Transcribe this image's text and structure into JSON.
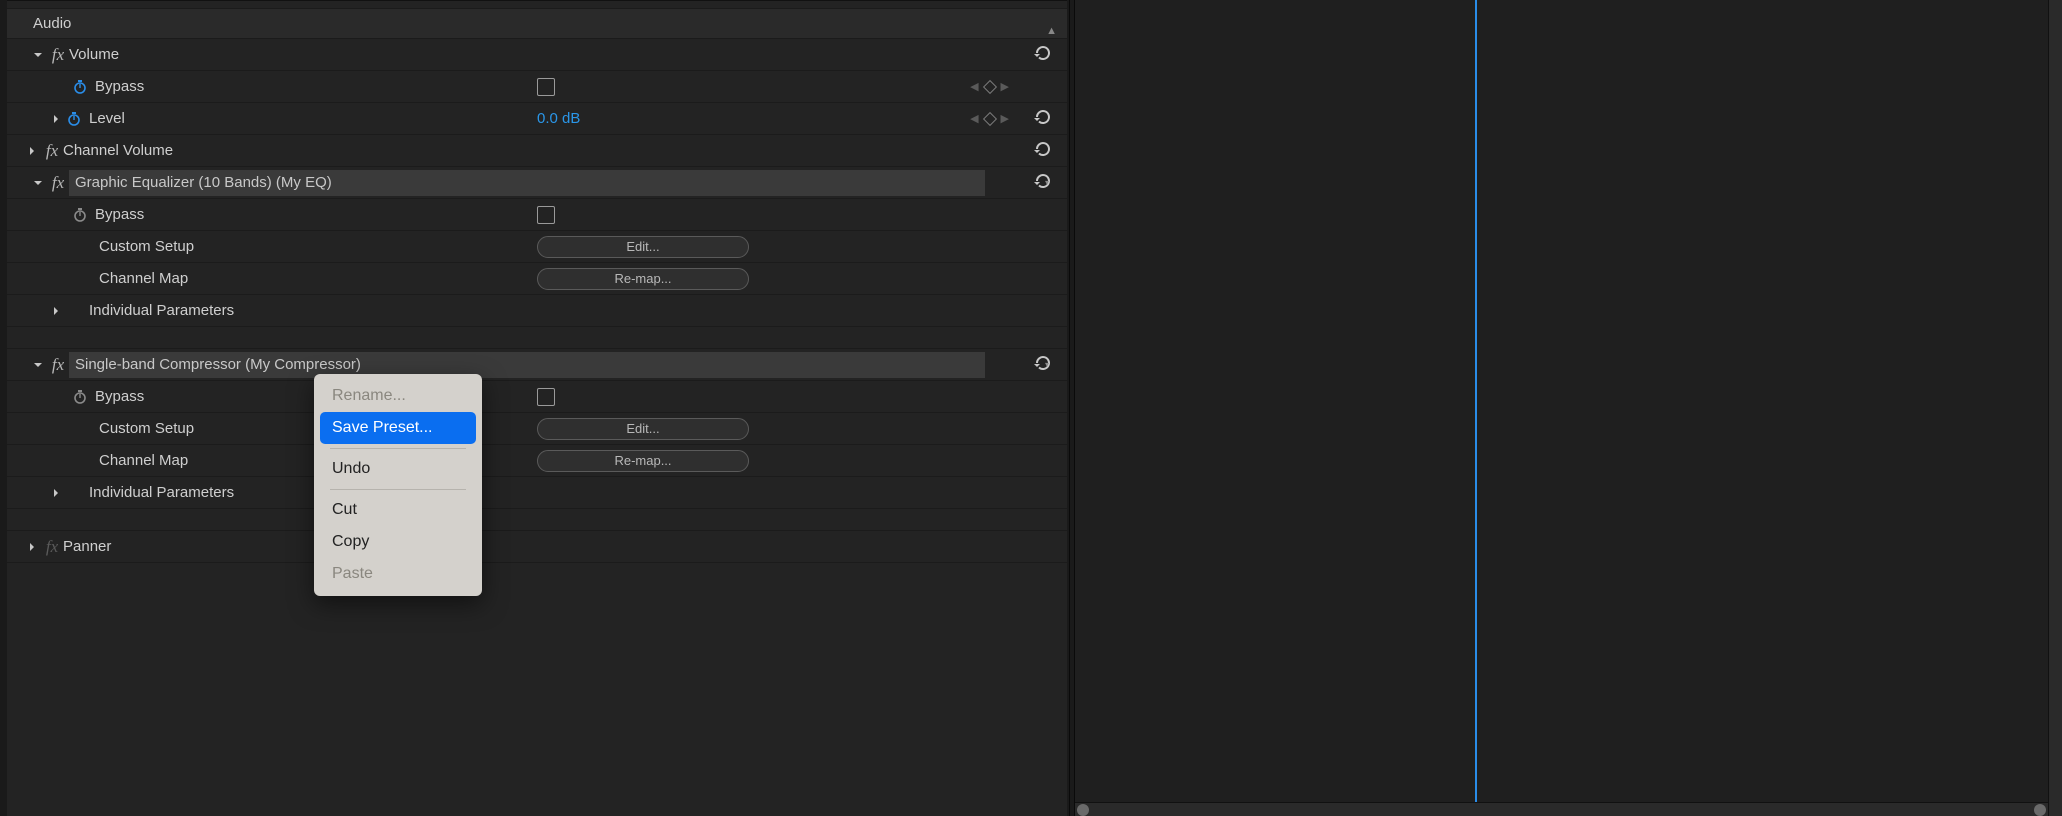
{
  "header": {
    "audio": "Audio"
  },
  "volume": {
    "title": "Volume",
    "bypass": "Bypass",
    "level": "Level",
    "level_value": "0.0 dB"
  },
  "channel_volume": {
    "title": "Channel Volume"
  },
  "eq": {
    "title": "Graphic Equalizer (10 Bands) (My EQ)",
    "bypass": "Bypass",
    "custom_setup": "Custom Setup",
    "channel_map": "Channel Map",
    "individual": "Individual Parameters",
    "edit_btn": "Edit...",
    "remap_btn": "Re-map..."
  },
  "comp": {
    "title": "Single-band Compressor (My Compressor)",
    "bypass": "Bypass",
    "custom_setup": "Custom Setup",
    "channel_map": "Channel Map",
    "individual": "Individual Parameters",
    "edit_btn": "Edit...",
    "remap_btn": "Re-map..."
  },
  "panner": {
    "title": "Panner"
  },
  "ctx": {
    "rename": "Rename...",
    "save_preset": "Save Preset...",
    "undo": "Undo",
    "cut": "Cut",
    "copy": "Copy",
    "paste": "Paste"
  }
}
